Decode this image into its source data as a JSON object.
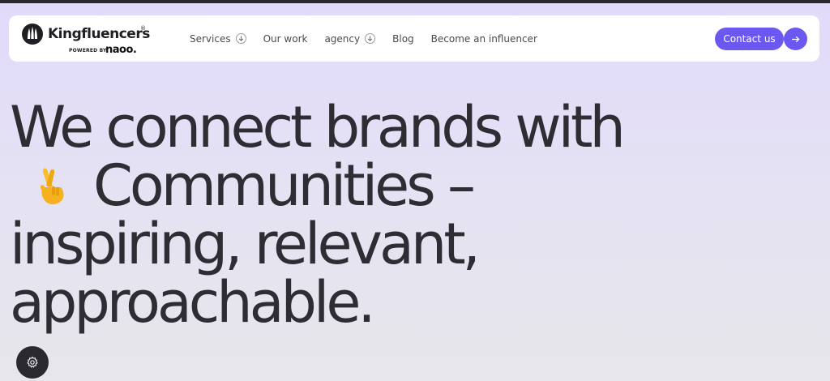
{
  "header": {
    "brand_name": "Kingfluencers",
    "brand_reg_mark": "®",
    "powered_by_label": "POWERED BY",
    "powered_by_brand": "naoo.",
    "nav": [
      {
        "label": "Services",
        "has_dropdown": true
      },
      {
        "label": "Our work",
        "has_dropdown": false
      },
      {
        "label": "agency",
        "has_dropdown": true
      },
      {
        "label": "Blog",
        "has_dropdown": false
      },
      {
        "label": "Become an influencer",
        "has_dropdown": false
      }
    ],
    "contact_label": "Contact us"
  },
  "hero": {
    "line1": "We connect brands with",
    "emoji_icon": "crossed-fingers-icon",
    "line2": "Communities –",
    "line3": "inspiring, relevant,",
    "line4": "approachable."
  },
  "floating": {
    "settings_icon": "gear-icon"
  },
  "colors": {
    "accent": "#6b58f0",
    "text": "#2f2d33",
    "background_top": "#e1dafa",
    "background_bottom": "#e7e6ea",
    "dark": "#2a292e"
  }
}
